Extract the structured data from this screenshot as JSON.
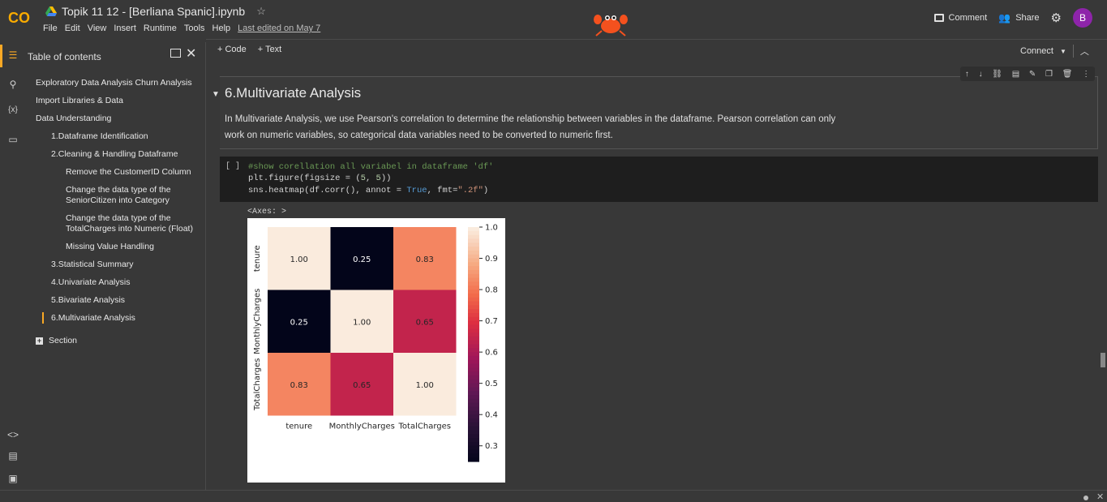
{
  "app": {
    "notebook_title": "Topik 11 12 - [Berliana Spanic].ipynb",
    "menu": [
      "File",
      "Edit",
      "View",
      "Insert",
      "Runtime",
      "Tools",
      "Help"
    ],
    "last_edited": "Last edited on May 7",
    "comment_label": "Comment",
    "share_label": "Share",
    "avatar_initial": "B",
    "logo_text": "CO"
  },
  "toolbar": {
    "code_label": "+ Code",
    "text_label": "+ Text",
    "connect_label": "Connect"
  },
  "sidebar": {
    "title": "Table of contents",
    "items": [
      {
        "label": "Exploratory Data Analysis Churn Analysis",
        "level": 1
      },
      {
        "label": "Import Libraries & Data",
        "level": 1
      },
      {
        "label": "Data Understanding",
        "level": 1
      },
      {
        "label": "1.Dataframe Identification",
        "level": 2
      },
      {
        "label": "2.Cleaning & Handling Dataframe",
        "level": 2
      },
      {
        "label": "Remove the CustomerID Column",
        "level": 3
      },
      {
        "label": "Change the data type of the SeniorCitizen into Category",
        "level": 3
      },
      {
        "label": "Change the data type of the TotalCharges into Numeric (Float)",
        "level": 3
      },
      {
        "label": "Missing Value Handling",
        "level": 3
      },
      {
        "label": "3.Statistical Summary",
        "level": 2
      },
      {
        "label": "4.Univariate Analysis",
        "level": 2
      },
      {
        "label": "5.Bivariate Analysis",
        "level": 2
      },
      {
        "label": "6.Multivariate Analysis",
        "level": 2,
        "active": true
      }
    ],
    "section_label": "Section"
  },
  "text_cell": {
    "heading": "6.Multivariate Analysis",
    "body": "In Multivariate Analysis, we use Pearson's correlation to determine the relationship between variables in the dataframe. Pearson correlation can only work on numeric variables, so categorical data variables need to be converted to numeric first."
  },
  "code_cell": {
    "run_indicator": "[ ]",
    "line1": "#show corellation all variabel in dataframe 'df'",
    "line2_a": "plt.figure(figsize = (",
    "line2_num1": "5",
    "line2_b": ", ",
    "line2_num2": "5",
    "line2_c": "))",
    "line3_a": "sns.heatmap(df.corr(), annot = ",
    "line3_kw": "True",
    "line3_b": ", fmt=",
    "line3_str": "\".2f\"",
    "line3_c": ")"
  },
  "output": {
    "label": "<Axes: >"
  },
  "chart_data": {
    "type": "heatmap",
    "categories": [
      "tenure",
      "MonthlyCharges",
      "TotalCharges"
    ],
    "values": [
      [
        1.0,
        0.25,
        0.83
      ],
      [
        0.25,
        1.0,
        0.65
      ],
      [
        0.83,
        0.65,
        1.0
      ]
    ],
    "labels": [
      [
        "1.00",
        "0.25",
        "0.83"
      ],
      [
        "0.25",
        "1.00",
        "0.65"
      ],
      [
        "0.83",
        "0.65",
        "1.00"
      ]
    ],
    "colorbar_ticks": [
      "1.0",
      "0.9",
      "0.8",
      "0.7",
      "0.6",
      "0.5",
      "0.4",
      "0.3"
    ],
    "colorbar_tick_values": [
      1.0,
      0.9,
      0.8,
      0.7,
      0.6,
      0.5,
      0.4,
      0.3
    ],
    "vmin": 0.25,
    "vmax": 1.0,
    "colormap": "rocket"
  }
}
